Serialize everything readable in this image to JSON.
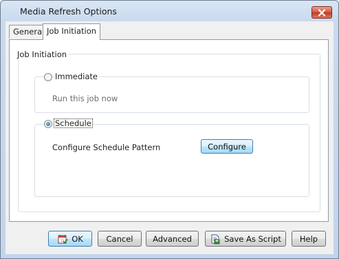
{
  "window": {
    "title": "Media Refresh Options"
  },
  "tabs": [
    {
      "label": "General",
      "active": false
    },
    {
      "label": "Job Initiation",
      "active": true
    }
  ],
  "job_initiation": {
    "group_label": "Job Initiation",
    "immediate": {
      "label": "Immediate",
      "checked": false,
      "description": "Run this job now"
    },
    "schedule": {
      "label": "Schedule",
      "checked": true,
      "pattern_label": "Configure Schedule Pattern",
      "configure_button": "Configure"
    }
  },
  "footer": {
    "ok": "OK",
    "cancel": "Cancel",
    "advanced": "Advanced",
    "save_as_script": "Save As Script",
    "help": "Help"
  },
  "icons": {
    "ok": "calendar-check-icon",
    "save_as_script": "script-save-icon",
    "close": "close-icon"
  },
  "colors": {
    "close_button": "#c94d39",
    "focused_button": "#bee6fd"
  }
}
